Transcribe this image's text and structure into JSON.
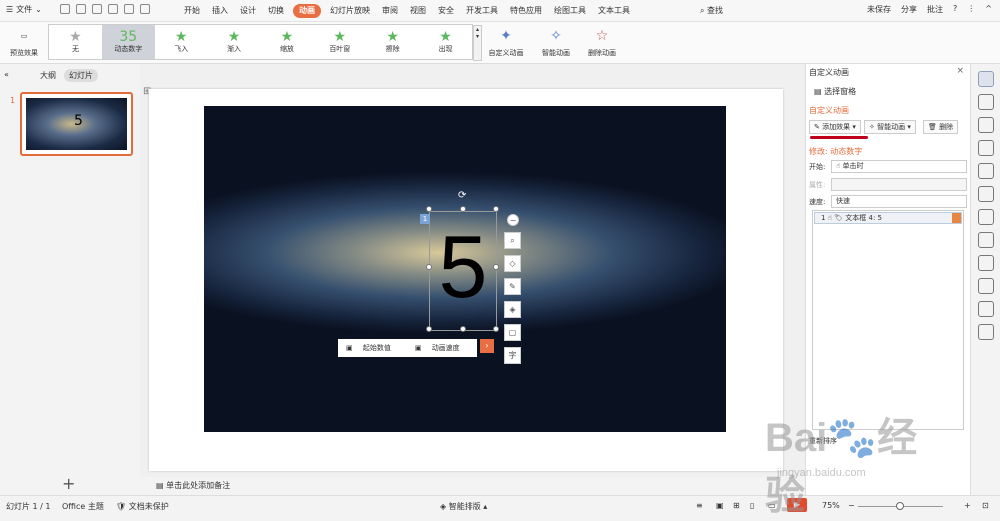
{
  "menubar": {
    "file_label": "文件",
    "tabs": [
      "开始",
      "插入",
      "设计",
      "切换",
      "动画",
      "幻灯片放映",
      "审阅",
      "视图",
      "安全",
      "开发工具",
      "特色应用",
      "绘图工具",
      "文本工具"
    ],
    "active_tab": "动画",
    "search_label": "查找",
    "right": [
      "未保存",
      "分享",
      "批注"
    ]
  },
  "ribbon": {
    "preview_label": "预览效果",
    "gallery": [
      "无",
      "动态数字",
      "飞入",
      "渐入",
      "缩放",
      "百叶窗",
      "擦除",
      "出现"
    ],
    "selected": "动态数字",
    "custom_label": "自定义动画",
    "smart_label": "智能动画",
    "delete_label": "删除动画"
  },
  "leftpanel": {
    "outline_label": "大纲",
    "slides_label": "幻灯片",
    "slide_number": "1",
    "thumb_text": "5"
  },
  "slide": {
    "big_number": "5",
    "badge": "1",
    "numbar": [
      "起始数值",
      "动画速度"
    ],
    "tool_text": "字"
  },
  "notes_placeholder": "单击此处添加备注",
  "rightpanel": {
    "title": "自定义动画",
    "select_pane": "选择窗格",
    "section": "自定义动画",
    "add_effect": "添加效果",
    "smart_anim": "智能动画",
    "delete": "删除",
    "modify": "修改: 动态数字",
    "start_label": "开始:",
    "start_value": "单击时",
    "prop_label": "属性:",
    "speed_label": "速度:",
    "speed_value": "快速",
    "list_item": "1 ☝  🏷  文本框 4: 5",
    "bottom_text": "重新排序"
  },
  "statusbar": {
    "slide_info": "幻灯片 1 / 1",
    "theme": "Office 主题",
    "protect": "文档未保护",
    "smart_layout": "智能排版",
    "zoom": "75%"
  },
  "watermark": {
    "brand": "Bai",
    "brand2": "经验",
    "url": "jingyan.baidu.com"
  },
  "colors": {
    "accent": "#e86f43",
    "redline": "#c0001a"
  }
}
